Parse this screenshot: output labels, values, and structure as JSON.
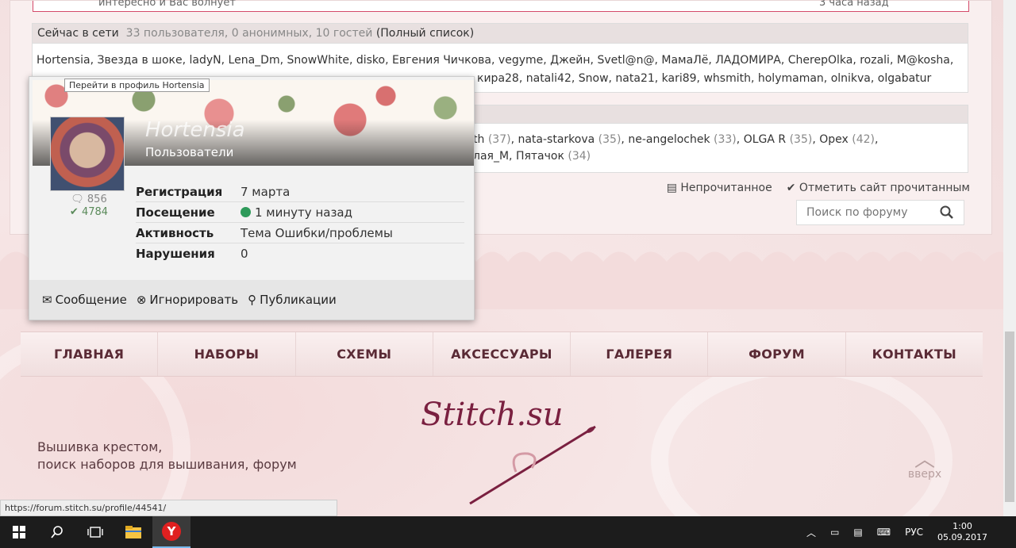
{
  "top_item": {
    "text": "интересно и Вас волнует",
    "time": "3 часа назад"
  },
  "online": {
    "title": "Сейчас в сети",
    "counts": "33 пользователя, 0 анонимных, 10 гостей",
    "full_list": "(Полный список)",
    "line1": "Hortensia, Звезда в шоке, ladyN, Lena_Dm, SnowWhite, disko, Евгения Чичкова, vegyme, Джейн, Svetl@n@, МамаЛё, ЛАДОМИРА, CherepOlka, rozali, M@kosha,",
    "line2_tail": "кира28, natali42, Snow, nata21, kari89, whsmith, holymaman, olnikva, olgabatur"
  },
  "birthdays": {
    "line1": [
      {
        "name": "th",
        "age": "(37)"
      },
      {
        "name": "nata-starkova",
        "age": "(35)"
      },
      {
        "name": "ne-angelochek",
        "age": "(33)"
      },
      {
        "name": "OLGA R",
        "age": "(35)"
      },
      {
        "name": "Opex",
        "age": "(42)"
      }
    ],
    "line2": [
      {
        "name": "лая_М",
        "age": ""
      },
      {
        "name": "Пятачок",
        "age": "(34)"
      }
    ]
  },
  "actions": {
    "unread": "Непрочитанное",
    "mark_read": "Отметить сайт прочитанным"
  },
  "search": {
    "placeholder": "Поиск по форуму"
  },
  "popup": {
    "tooltip": "Перейти в профиль Hortensia",
    "username": "Hortensia",
    "group": "Пользователи",
    "comments": "856",
    "likes": "4784",
    "rows": [
      {
        "key": "Регистрация",
        "value": "7 марта"
      },
      {
        "key": "Посещение",
        "value": "1 минуту назад"
      },
      {
        "key": "Активность",
        "value": "Тема Ошибки/проблемы"
      },
      {
        "key": "Нарушения",
        "value": "0"
      }
    ],
    "buttons": {
      "message": "Сообщение",
      "ignore": "Игнорировать",
      "posts": "Публикации"
    }
  },
  "nav": [
    "ГЛАВНАЯ",
    "НАБОРЫ",
    "СХЕМЫ",
    "АКСЕССУАРЫ",
    "ГАЛЕРЕЯ",
    "ФОРУМ",
    "КОНТАКТЫ"
  ],
  "footer": {
    "line1": "Вышивка крестом,",
    "line2": "поиск наборов для вышивания, форум",
    "logo": "Stitch.su",
    "up": "вверх"
  },
  "status_url": "https://forum.stitch.su/profile/44541/",
  "taskbar": {
    "lang": "РУС",
    "time": "1:00",
    "date": "05.09.2017"
  },
  "colors": {
    "accent": "#5a2a35",
    "online_dot": "#2e9a5a",
    "background": "#f6e6e6"
  }
}
